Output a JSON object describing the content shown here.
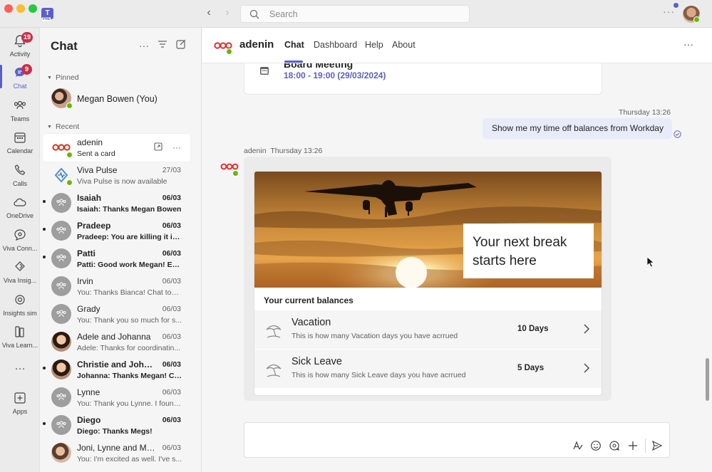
{
  "window": {
    "search_placeholder": "Search",
    "more_label": "···"
  },
  "rail": {
    "items": [
      {
        "label": "Activity",
        "badge": "19"
      },
      {
        "label": "Chat",
        "badge": "9"
      },
      {
        "label": "Teams"
      },
      {
        "label": "Calendar"
      },
      {
        "label": "Calls"
      },
      {
        "label": "OneDrive"
      },
      {
        "label": "Viva Conn..."
      },
      {
        "label": "Viva Insig..."
      },
      {
        "label": "Insights sim"
      },
      {
        "label": "Viva Learn..."
      },
      {
        "label": "···"
      },
      {
        "label": "Apps"
      }
    ]
  },
  "chatlist": {
    "title": "Chat",
    "pinned_label": "Pinned",
    "recent_label": "Recent",
    "pinned": [
      {
        "name": "Megan Bowen (You)"
      }
    ],
    "recent": [
      {
        "name": "adenin",
        "preview": "Sent a card",
        "date": ""
      },
      {
        "name": "Viva Pulse",
        "preview": "Viva Pulse is now available",
        "date": "27/03"
      },
      {
        "name": "Isaiah",
        "preview": "Isaiah: Thanks Megan Bowen",
        "date": "06/03"
      },
      {
        "name": "Pradeep",
        "preview": "Pradeep: You are killing it in ...",
        "date": "06/03"
      },
      {
        "name": "Patti",
        "preview": "Patti: Good work Megan! Exc...",
        "date": "06/03"
      },
      {
        "name": "Irvin",
        "preview": "You: Thanks Bianca! Chat tom...",
        "date": "06/03"
      },
      {
        "name": "Grady",
        "preview": "You: Thank you so much for s...",
        "date": "06/03"
      },
      {
        "name": "Adele and Johanna",
        "preview": "Adele: Thanks for coordinatin...",
        "date": "06/03"
      },
      {
        "name": "Christie and Joha...",
        "preview": "Johanna: Thanks Megan! Ch...",
        "date": "06/03"
      },
      {
        "name": "Lynne",
        "preview": "You: Thank you Lynne. I found...",
        "date": "06/03"
      },
      {
        "name": "Diego",
        "preview": "Diego: Thanks Megs!",
        "date": "06/03"
      },
      {
        "name": "Joni, Lynne and Mir...",
        "preview": "You: I'm excited as well. I've s...",
        "date": "06/03"
      }
    ]
  },
  "main": {
    "title": "adenin",
    "tabs": [
      "Chat",
      "Dashboard",
      "Help",
      "About"
    ],
    "meeting": {
      "title": "Board Meeting",
      "time": "18:00 - 19:00 (29/03/2024)"
    },
    "my_message": {
      "time": "Thursday 13:26",
      "text": "Show me my time off balances from Workday"
    },
    "bot_message": {
      "sender": "adenin",
      "time": "Thursday 13:26",
      "hero_line1": "Your next break",
      "hero_line2": "starts here",
      "balances_heading": "Your current balances",
      "balances": [
        {
          "title": "Vacation",
          "desc": "This is how many Vacation days you have acrrued",
          "value": "10",
          "unit": "Days"
        },
        {
          "title": "Sick Leave",
          "desc": "This is how many Sick Leave days you have acrrued",
          "value": "5",
          "unit": "Days"
        }
      ]
    }
  },
  "colors": {
    "accent": "#5b5fc7",
    "badge": "#c4314b",
    "presence": "#6bb700",
    "brand_red": "#e0302d"
  }
}
